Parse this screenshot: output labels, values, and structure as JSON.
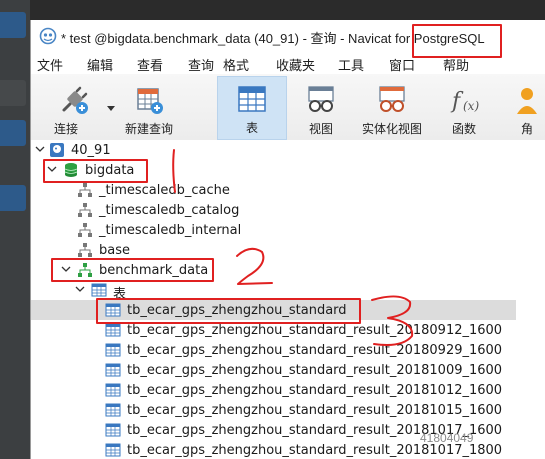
{
  "window": {
    "title": "* test @bigdata.benchmark_data (40_91) - 查询 - Navicat for PostgreSQL"
  },
  "menu": [
    "文件",
    "编辑",
    "查看",
    "查询",
    "格式",
    "收藏夹",
    "工具",
    "窗口",
    "帮助"
  ],
  "toolbar": {
    "connect": "连接",
    "new_query": "新建查询",
    "table": "表",
    "view": "视图",
    "mat_view": "实体化视图",
    "function": "函数",
    "partial": "角"
  },
  "tree": {
    "server": "40_91",
    "database": "bigdata",
    "schemas": [
      "_timescaledb_cache",
      "_timescaledb_catalog",
      "_timescaledb_internal",
      "base"
    ],
    "schema_open": "benchmark_data",
    "tables_group": "表",
    "tables": [
      "tb_ecar_gps_zhengzhou_standard",
      "tb_ecar_gps_zhengzhou_standard_result_20180912_1600",
      "tb_ecar_gps_zhengzhou_standard_result_20180929_1600",
      "tb_ecar_gps_zhengzhou_standard_result_20181009_1600",
      "tb_ecar_gps_zhengzhou_standard_result_20181012_1600",
      "tb_ecar_gps_zhengzhou_standard_result_20181015_1600",
      "tb_ecar_gps_zhengzhou_standard_result_20181017_1600",
      "tb_ecar_gps_zhengzhou_standard_result_20181017_1800"
    ]
  },
  "watermark": "41804049",
  "annotation": {
    "color": "#e02020"
  }
}
